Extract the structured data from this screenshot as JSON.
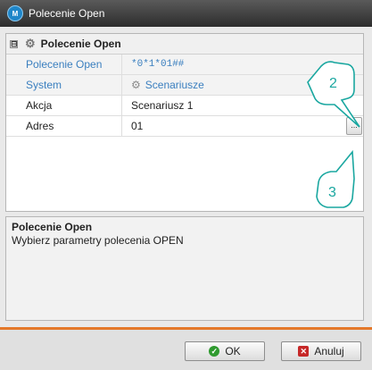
{
  "window": {
    "title": "Polecenie Open",
    "app_icon": "app-logo-icon"
  },
  "group": {
    "label": "Polecenie Open",
    "expander": "⊟"
  },
  "rows": [
    {
      "name": "Polecenie Open",
      "value": "*0*1*01##"
    },
    {
      "name": "System",
      "value": "Scenariusze"
    },
    {
      "name": "Akcja",
      "value": "Scenariusz 1"
    },
    {
      "name": "Adres",
      "value": "01",
      "browse": "..."
    }
  ],
  "description": {
    "title": "Polecenie Open",
    "text": "Wybierz parametry polecenia OPEN"
  },
  "buttons": {
    "ok": "OK",
    "cancel": "Anuluj"
  },
  "callouts": {
    "first": "2",
    "second": "3"
  },
  "colors": {
    "accent": "#e4782a",
    "readonly_text": "#3a7fbf",
    "callout": "#1aa7a0"
  }
}
